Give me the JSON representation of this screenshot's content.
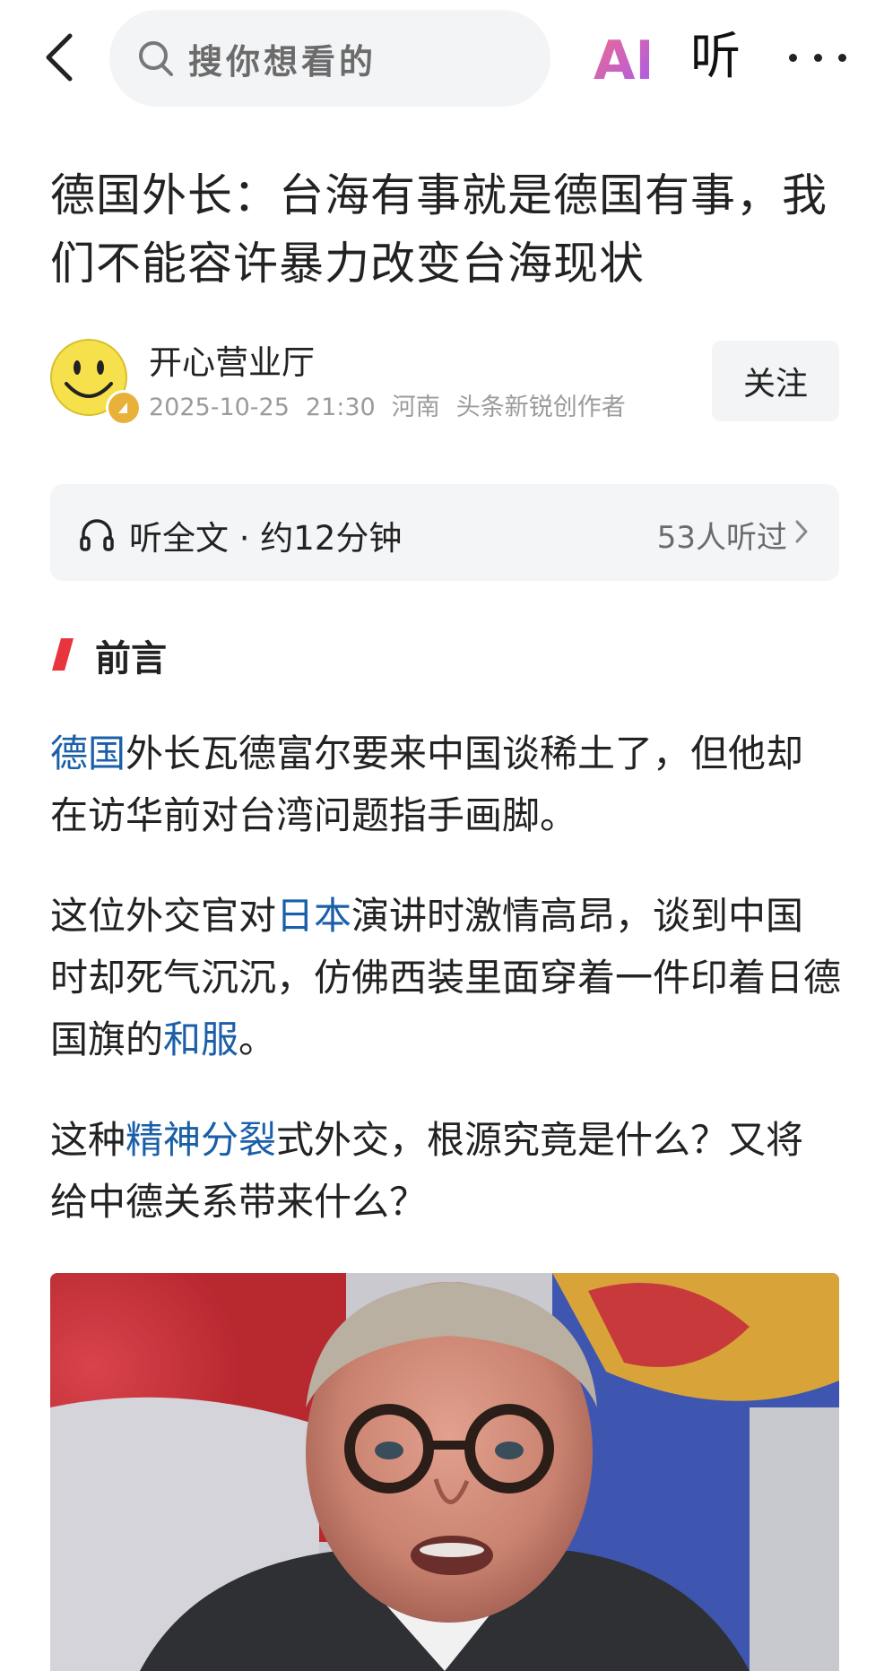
{
  "header": {
    "search_placeholder": "搜你想看的",
    "ai_label": "AI",
    "listen_label": "听"
  },
  "article": {
    "title": "德国外长：台海有事就是德国有事，我们不能容许暴力改变台海现状",
    "author": {
      "name": "开心营业厅",
      "date": "2025-10-25",
      "time": "21:30",
      "location": "河南",
      "role": "头条新锐创作者",
      "follow_label": "关注"
    },
    "audio": {
      "label": "听全文 · 约12分钟",
      "listeners": "53人听过"
    },
    "section_title": "前言",
    "paragraphs": [
      [
        {
          "text": "德国",
          "link": true
        },
        {
          "text": "外长瓦德富尔要来中国谈稀土了，但他却在访华前对台湾问题指手画脚。",
          "link": false
        }
      ],
      [
        {
          "text": "这位外交官对",
          "link": false
        },
        {
          "text": "日本",
          "link": true
        },
        {
          "text": "演讲时激情高昂，谈到中国时却死气沉沉，仿佛西装里面穿着一件印着日德国旗的",
          "link": false
        },
        {
          "text": "和服",
          "link": true
        },
        {
          "text": "。",
          "link": false
        }
      ],
      [
        {
          "text": "这种",
          "link": false
        },
        {
          "text": "精神分裂",
          "link": true
        },
        {
          "text": "式外交，根源究竟是什么？又将给中德关系带来什么？",
          "link": false
        }
      ]
    ]
  },
  "colors": {
    "link": "#1a5fa8",
    "section_accent": "#e8343c",
    "ai_gradient_start": "#f06a8c",
    "ai_gradient_end": "#a45cf0"
  }
}
